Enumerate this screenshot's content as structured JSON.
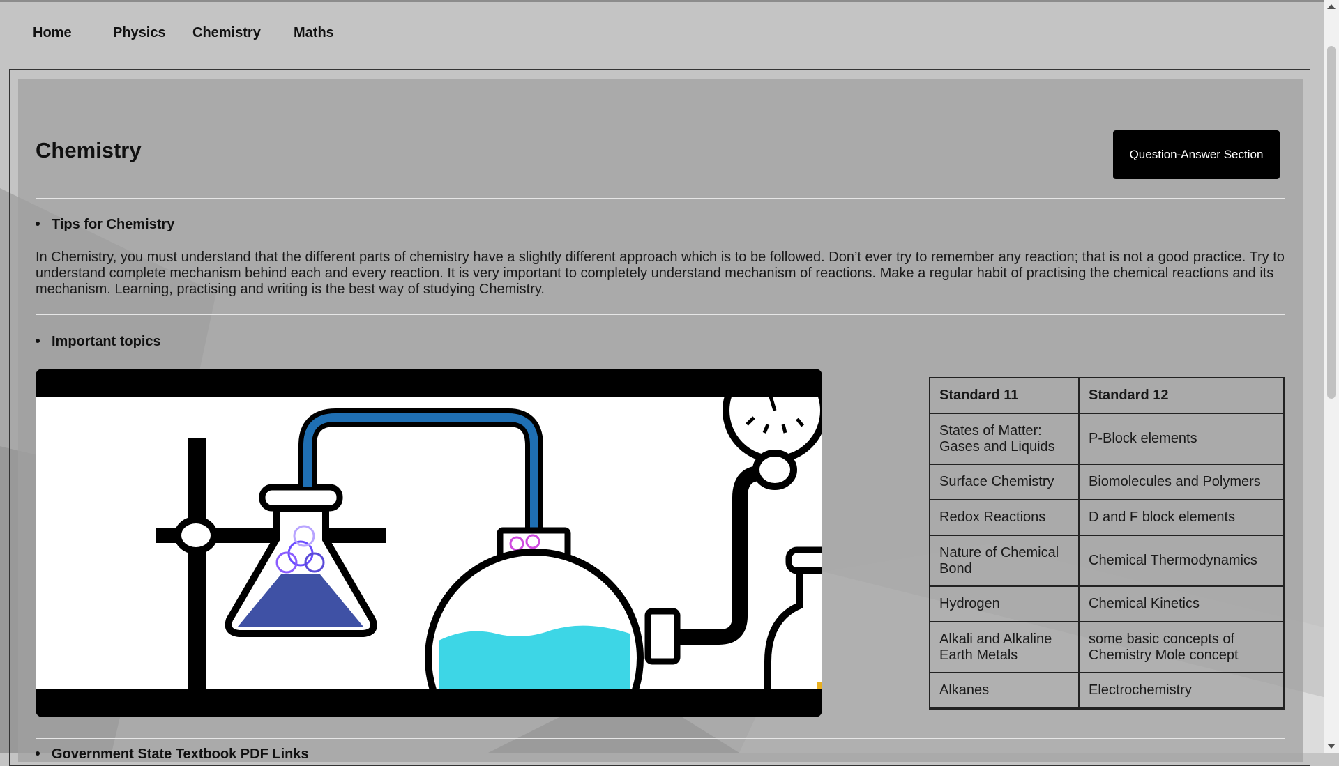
{
  "nav": {
    "items": [
      {
        "label": "Home"
      },
      {
        "label": "Physics"
      },
      {
        "label": "Chemistry"
      },
      {
        "label": "Maths"
      }
    ]
  },
  "main": {
    "title": "Chemistry",
    "qa_button": "Question-Answer Section",
    "tips_heading": "Tips for Chemistry",
    "tips_text": "In Chemistry, you must understand that the different parts of chemistry have a slightly different approach which is to be followed. Don’t ever try to remember any reaction; that is not a good practice. Try to understand complete mechanism behind each and every reaction. It is very important to completely understand mechanism of reactions. Make a regular habit of practising the chemical reactions and its mechanism. Learning, practising and writing is the best way of studying Chemistry.",
    "topics_heading": "Important topics",
    "next_heading_partial": "Government State Textbook PDF Links",
    "table": {
      "headers": [
        "Standard 11",
        "Standard 12"
      ],
      "rows": [
        [
          "States of Matter: Gases and Liquids",
          "P-Block elements"
        ],
        [
          "Surface Chemistry",
          "Biomolecules and Polymers"
        ],
        [
          "Redox Reactions",
          "D and F block elements"
        ],
        [
          "Nature of Chemical Bond",
          "Chemical Thermodynamics"
        ],
        [
          "Hydrogen",
          "Chemical Kinetics"
        ],
        [
          "Alkali and Alkaline Earth Metals",
          "some basic concepts of Chemistry Mole concept"
        ],
        [
          "Alkanes",
          "Electrochemistry"
        ]
      ]
    }
  },
  "illustration": {
    "icon": "chemistry-lab-apparatus-illustration",
    "colors": {
      "flask_liquid": "#3f51a5",
      "bulb_liquid": "#3dd6e6",
      "tube": "#1f6fb3",
      "bubbles": "#8a5cff"
    }
  },
  "colors": {
    "page_bg": "#c4c4c4",
    "button_bg": "#000000",
    "button_text": "#ffffff"
  }
}
